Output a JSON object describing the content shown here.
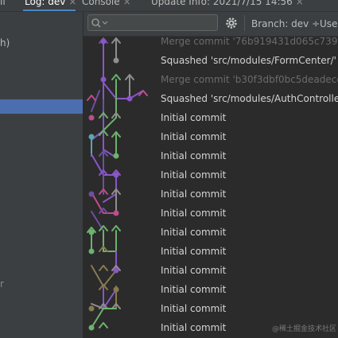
{
  "tabs": [
    {
      "label": "ll",
      "active": false,
      "closable": false
    },
    {
      "label": "Log: dev",
      "active": true,
      "closable": true
    },
    {
      "label": "Console",
      "active": false,
      "closable": true
    },
    {
      "label": "Update Info: 2021/7/15 14:56",
      "active": false,
      "closable": true
    }
  ],
  "tab_close_glyph": "×",
  "branch_panel": {
    "partial_items": [
      "h)",
      "r"
    ]
  },
  "toolbar": {
    "search_placeholder": "",
    "branch_filter": "Branch: dev ÷",
    "user_filter": "Use"
  },
  "commits": [
    {
      "message": "Merge commit '76b919431d065c7395",
      "dim": true
    },
    {
      "message": "Squashed 'src/modules/FormCenter/' c",
      "dim": false
    },
    {
      "message": "Merge commit 'b30f3dbf0bc5deadecd",
      "dim": true
    },
    {
      "message": "Squashed 'src/modules/AuthController",
      "dim": false
    },
    {
      "message": "Initial commit",
      "dim": false
    },
    {
      "message": "Initial commit",
      "dim": false
    },
    {
      "message": "Initial commit",
      "dim": false
    },
    {
      "message": "Initial commit",
      "dim": false
    },
    {
      "message": "Initial commit",
      "dim": false
    },
    {
      "message": "Initial commit",
      "dim": false
    },
    {
      "message": "Initial commit",
      "dim": false
    },
    {
      "message": "Initial commit",
      "dim": false
    },
    {
      "message": "Initial commit",
      "dim": false
    },
    {
      "message": "Initial commit",
      "dim": false
    },
    {
      "message": "Initial commit",
      "dim": false
    },
    {
      "message": "Initial commit",
      "dim": false
    }
  ],
  "colors": {
    "green": "#6cb36c",
    "purple": "#8a56c8",
    "pink": "#c04c8c",
    "teal": "#59a6b2",
    "grey": "#8f8f8f",
    "olive": "#877a4f",
    "violet": "#6e4fa3"
  },
  "watermark": "@稀土掘金技术社区"
}
